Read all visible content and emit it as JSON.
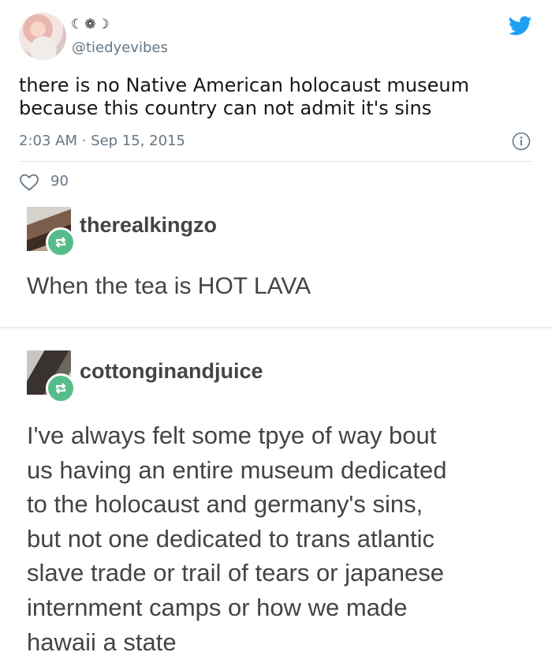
{
  "tweet": {
    "display_name": "☾❁☽",
    "handle": "@tiedyevibes",
    "text_lines": [
      "there is no Native American holocaust museum",
      "because this country can not admit it's sins"
    ],
    "timestamp": "2:03 AM · Sep 15, 2015",
    "like_count": "90",
    "brand_color": "#1da1f2"
  },
  "posts": [
    {
      "username": "therealkingzo",
      "text_lines": [
        "When the tea is HOT LAVA"
      ],
      "reblog_color": "#56bc8a"
    },
    {
      "username": "cottonginandjuice",
      "text_lines": [
        "I've always felt some tpye of way bout",
        "us having an entire museum dedicated",
        "to the holocaust and germany's sins,",
        "but not one dedicated to trans atlantic",
        "slave trade or trail of tears or japanese",
        "internment camps or how we made",
        "hawaii a state"
      ],
      "reblog_color": "#56bc8a"
    }
  ],
  "icons": {
    "twitter": "twitter-bird-icon",
    "info": "info-icon",
    "like": "heart-icon",
    "reblog": "reblog-icon"
  }
}
